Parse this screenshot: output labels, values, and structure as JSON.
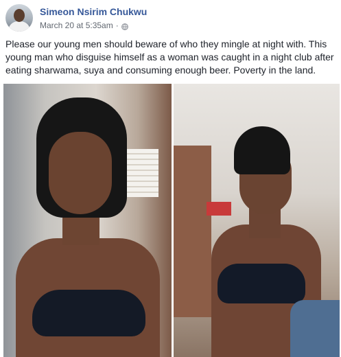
{
  "post": {
    "author": "Simeon Nsirim Chukwu",
    "timestamp": "March 20 at 5:35am",
    "separator": "·",
    "privacy_icon": "globe-icon",
    "text": "Please our young men should beware of who they mingle at night with. This young man who disguise himself as a woman was caught in a night club after eating sharwama, suya and consuming enough beer. Poverty in the land.",
    "photos": [
      {
        "name": "photo-left",
        "subject": "person in black wig and black bra"
      },
      {
        "name": "photo-right",
        "subject": "same person without wig in black bra"
      }
    ]
  },
  "colors": {
    "author_link": "#365899",
    "meta_text": "#616770",
    "body_text": "#1d2129"
  }
}
